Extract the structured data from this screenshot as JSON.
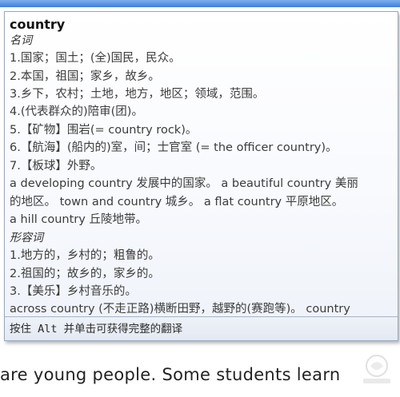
{
  "popup": {
    "headword": "country",
    "noun_label": "名词",
    "noun_senses": [
      "1.国家；国土；(全)国民，民众。",
      "2.本国，祖国；家乡，故乡。",
      "3.乡下，农村；土地，地方，地区；领域，范围。",
      "4.(代表群众的)陪审(团)。",
      "5.【矿物】围岩(= country rock)。",
      "6.【航海】(船内的)室，间；士官室 (= the officer country)。",
      "7.【板球】外野。"
    ],
    "noun_examples": [
      "a developing country 发展中的国家。 a beautiful country 美丽",
      "的地区。 town and country 城乡。 a flat country 平原地区。",
      "a hill country 丘陵地带。"
    ],
    "adj_label": "形容词",
    "adj_senses": [
      "1.地方的，乡村的；粗鲁的。",
      "2.祖国的；故乡的，家乡的。",
      "3.【美乐】乡村音乐的。"
    ],
    "adj_examples": [
      "across country (不走正路)横断田野，越野的(赛跑等)。 country"
    ],
    "footer_hint": "按住 Alt 并单击可获得完整的翻译"
  },
  "document": {
    "line": "are young people. Some students learn"
  },
  "colors": {
    "title_bar": "#3d80d8",
    "popup_border": "#9aa7ba",
    "footer_background": "#e3e9f3"
  }
}
